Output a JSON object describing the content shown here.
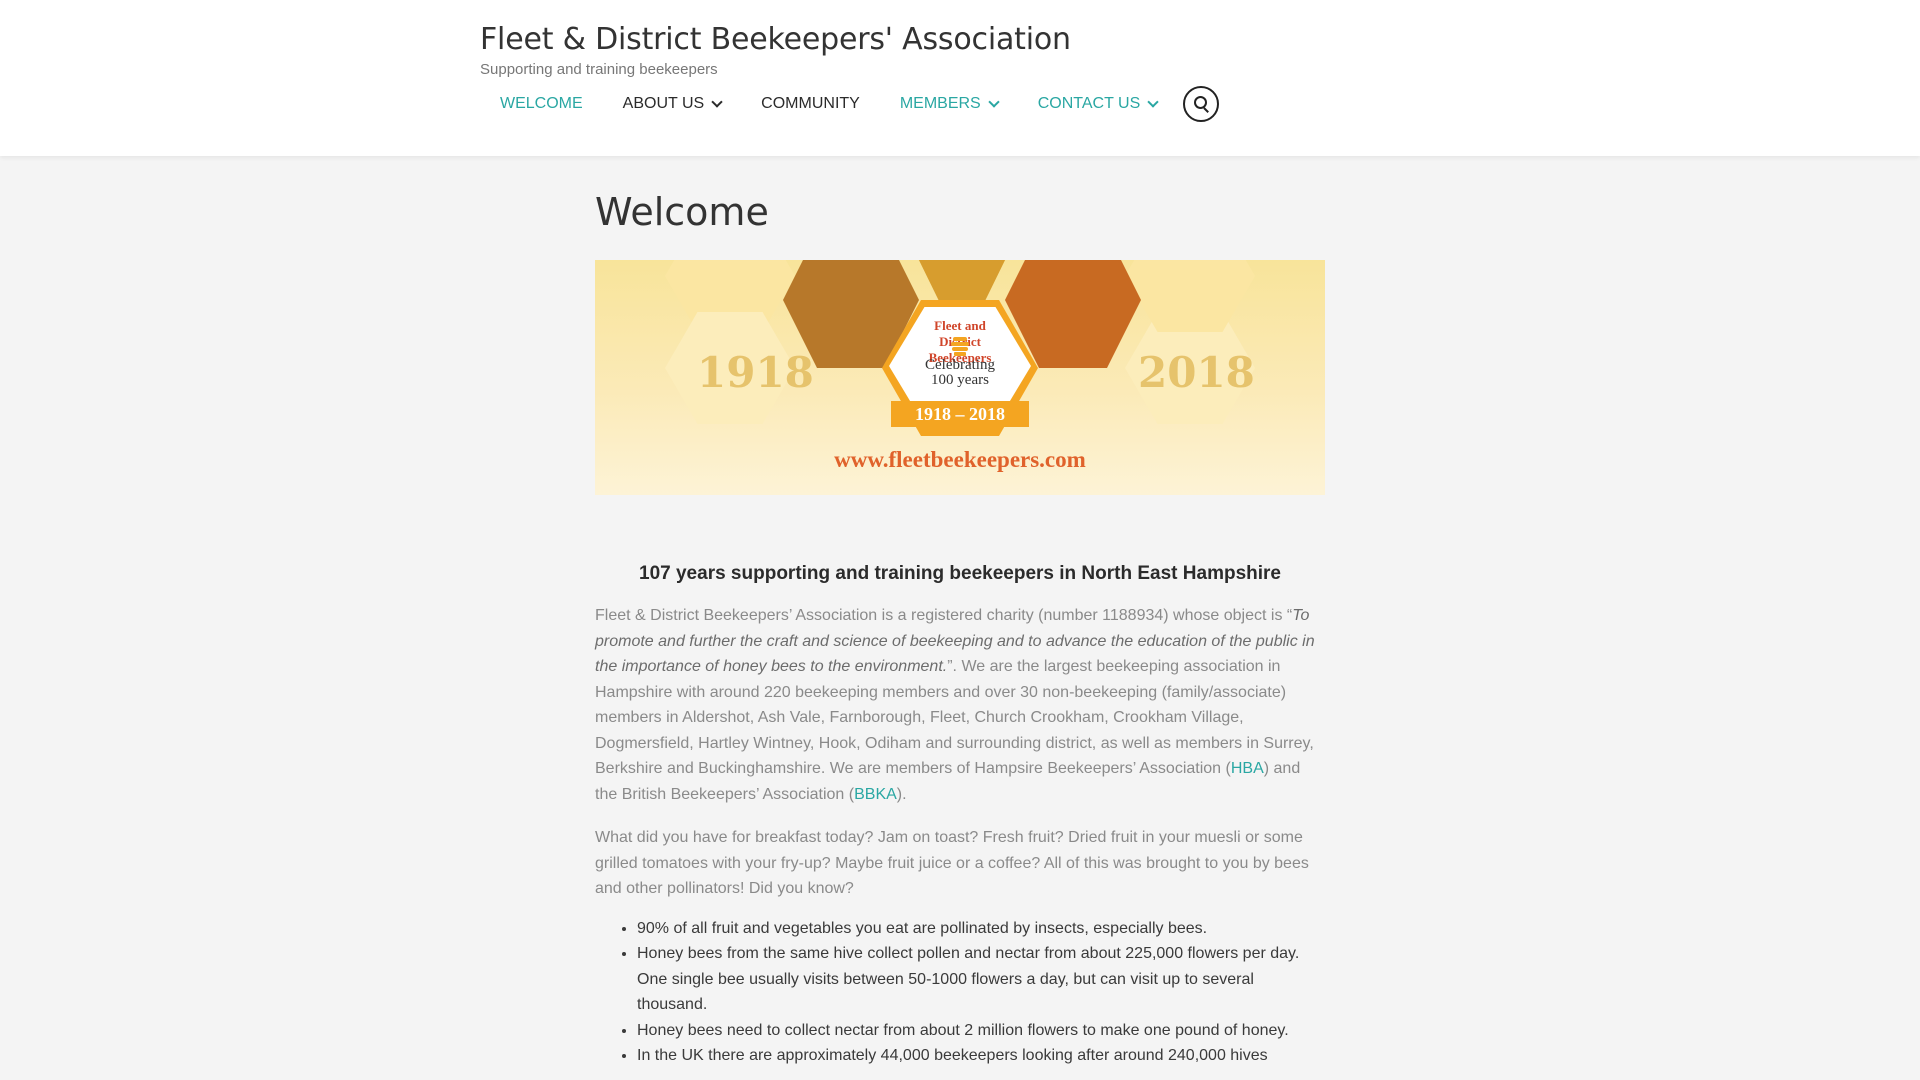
{
  "site": {
    "title": "Fleet & District Beekeepers' Association",
    "tagline": "Supporting and training beekeepers"
  },
  "nav": {
    "welcome": "WELCOME",
    "about": "ABOUT US",
    "community": "COMMUNITY",
    "members": "MEMBERS",
    "contact": "CONTACT US",
    "search_icon": "search-icon"
  },
  "page": {
    "title": "Welcome"
  },
  "banner": {
    "year_left": "1918",
    "year_right": "2018",
    "badge_ring": "Fleet and District Beekeepers",
    "badge_line1": "Celebrating",
    "badge_line2": "100 years",
    "badge_years": "1918 – 2018",
    "url": "www.fleetbeekeepers.com"
  },
  "content": {
    "subhead": "107 years supporting and training beekeepers in North East Hampshire",
    "p1_start": "Fleet & District Beekeepers’ Association is a registered charity (number 1188934) whose object is “",
    "p1_quote": "To promote and further the craft and science of beekeeping and to advance the education of the public in the importance of honey bees to the environment.",
    "p1_mid": "”. We are the largest beekeeping association in Hampshire with around 220 beekeeping members and over 30 non-beekeeping (family/associate) members in Aldershot, Ash Vale, Farnborough, Fleet, Church Crookham, Crookham Village, Dogmersfield, Hartley Wintney, Hook, Odiham and surrounding district, as well as members in Surrey, Berkshire and Buckinghamshire. We are  members of Hampsire Beekeepers’ Association (",
    "hba_link": "HBA",
    "p1_mid2": ") and the British Beekeepers’ Association (",
    "bbka_link": "BBKA",
    "p1_end": ").",
    "p2": "What did you have for breakfast today? Jam on toast? Fresh fruit? Dried fruit in your muesli or some grilled tomatoes with your fry-up? Maybe fruit juice or a coffee? All of this was brought to you by bees and other pollinators! Did you know?",
    "facts": [
      "90% of all fruit and vegetables you eat are pollinated by insects, especially bees.",
      "Honey bees from the same hive collect pollen and nectar from about 225,000 flowers per day. One single bee usually visits between 50-1000 flowers a day, but can visit up to several thousand.",
      "Honey bees need to collect nectar from about 2 million flowers to make one pound of honey.",
      "In the UK there are approximately 44,000 beekeepers looking after around 240,000 hives"
    ]
  }
}
